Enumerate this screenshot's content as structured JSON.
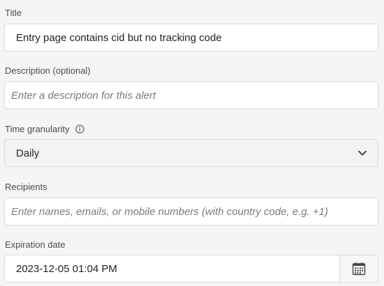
{
  "title": {
    "label": "Title",
    "value": "Entry page contains cid but no tracking code"
  },
  "description": {
    "label": "Description (optional)",
    "placeholder": "Enter a description for this alert"
  },
  "granularity": {
    "label": "Time granularity",
    "selected": "Daily"
  },
  "recipients": {
    "label": "Recipients",
    "placeholder": "Enter names, emails, or mobile numbers (with country code, e.g. +1)"
  },
  "expiration": {
    "label": "Expiration date",
    "value": "2023-12-05 01:04 PM"
  },
  "icons": {
    "info": "info-icon",
    "chevron": "chevron-down-icon",
    "calendar": "calendar-icon"
  }
}
